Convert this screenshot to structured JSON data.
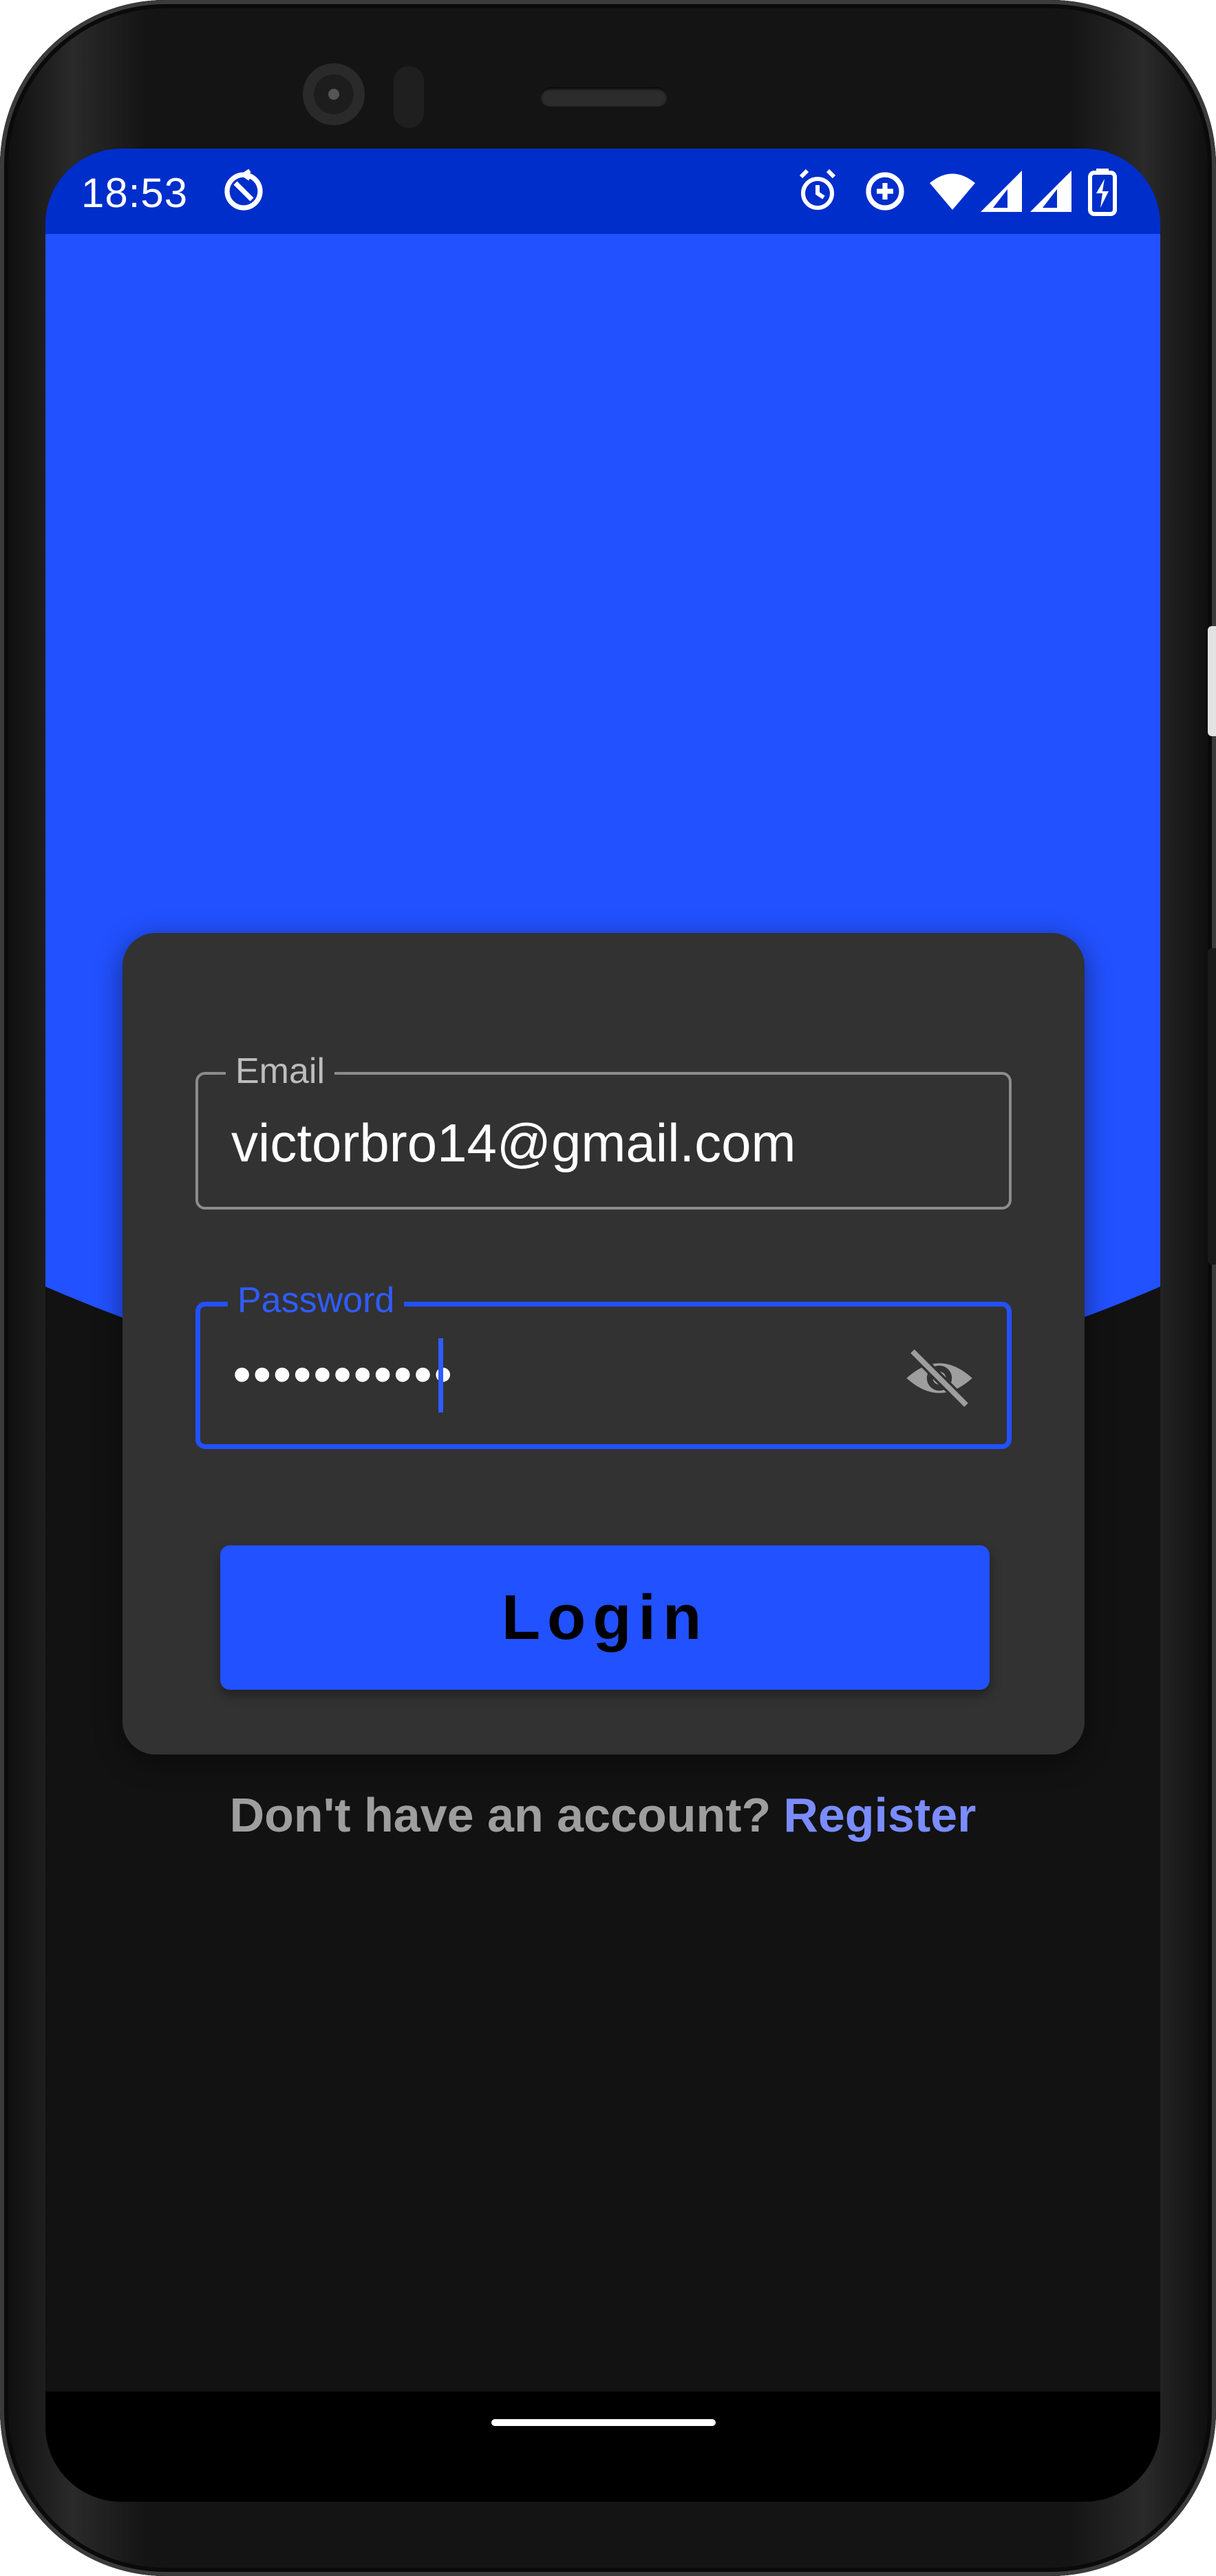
{
  "status_bar": {
    "time": "18:53",
    "left_icons": [
      "sync-disabled-icon"
    ],
    "right_icons": [
      "alarm-icon",
      "data-saver-icon",
      "wifi-icon",
      "signal-icon",
      "signal-icon",
      "battery-charging-icon"
    ]
  },
  "colors": {
    "primary": "#2251ff",
    "status_bar": "#002ecb",
    "background": "#121212",
    "card": "#323232",
    "link": "#7a8cff"
  },
  "login_form": {
    "email": {
      "label": "Email",
      "value": "victorbro14@gmail.com"
    },
    "password": {
      "label": "Password",
      "value": "•••••••••••",
      "toggle_icon": "visibility-off-icon"
    },
    "login_button": "Login"
  },
  "register_prompt": {
    "text": "Don't have an account?",
    "link": "Register"
  }
}
